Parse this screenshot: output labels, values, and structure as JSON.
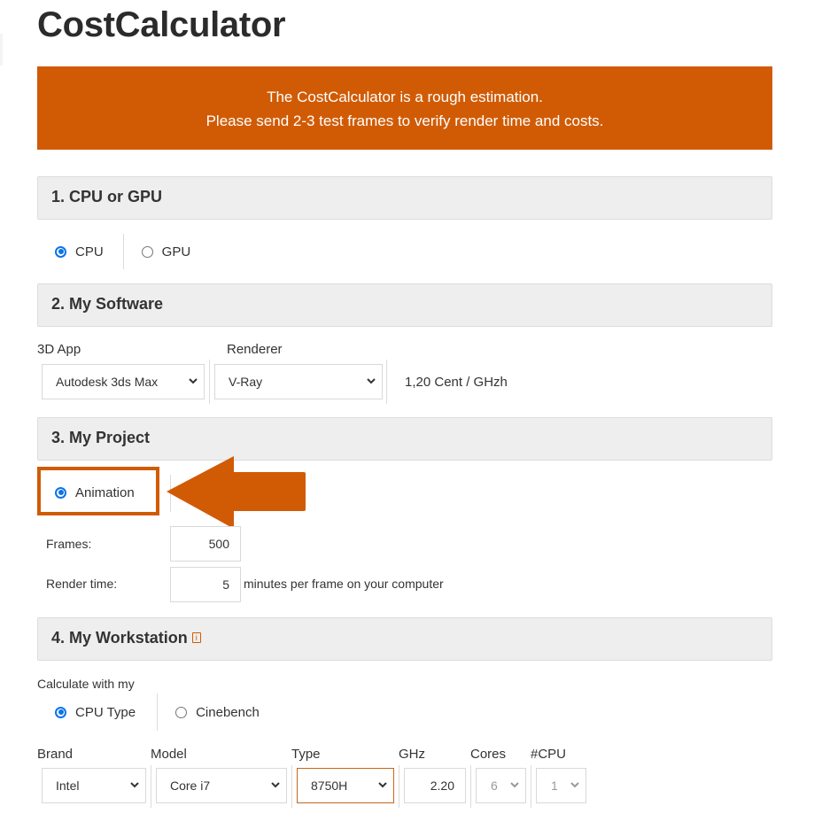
{
  "page": {
    "title": "CostCalculator",
    "notice_line1": "The CostCalculator is a rough estimation.",
    "notice_line2": "Please send 2-3 test frames to verify render time and costs.",
    "accent_color": "#d15b05"
  },
  "section1": {
    "title": "1. CPU or GPU",
    "options": [
      {
        "label": "CPU",
        "checked": true
      },
      {
        "label": "GPU",
        "checked": false
      }
    ]
  },
  "section2": {
    "title": "2. My Software",
    "app_label": "3D App",
    "app_value": "Autodesk 3ds Max",
    "renderer_label": "Renderer",
    "renderer_value": "V-Ray",
    "price": "1,20 Cent / GHzh"
  },
  "section3": {
    "title": "3. My Project",
    "mode_option": {
      "label": "Animation",
      "checked": true
    },
    "frames_label": "Frames:",
    "frames_value": "500",
    "render_time_label": "Render time:",
    "render_time_value": "5",
    "render_time_suffix": "minutes per frame on your computer"
  },
  "section4": {
    "title": "4. My Workstation",
    "info_icon": "info-icon",
    "calc_label": "Calculate with my",
    "options": [
      {
        "label": "CPU Type",
        "checked": true
      },
      {
        "label": "Cinebench",
        "checked": false
      }
    ],
    "brand_label": "Brand",
    "brand_value": "Intel",
    "model_label": "Model",
    "model_value": "Core i7",
    "type_label": "Type",
    "type_value": "8750H",
    "ghz_label": "GHz",
    "ghz_value": "2.20",
    "cores_label": "Cores",
    "cores_value": "6",
    "cpu_count_label": "#CPU",
    "cpu_count_value": "1"
  }
}
